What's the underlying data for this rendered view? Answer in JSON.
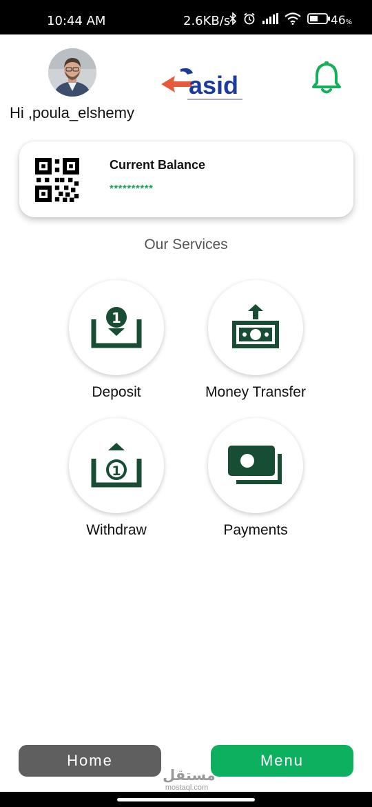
{
  "status_bar": {
    "time": "10:44 AM",
    "network_speed": "2.6KB/s",
    "battery": "46",
    "battery_unit": "%",
    "icons": [
      "bluetooth-icon",
      "alarm-icon",
      "signal-icon",
      "wifi-icon",
      "battery-icon"
    ]
  },
  "header": {
    "greeting": "Hi ,poula_elshemy",
    "logo_text": "asid",
    "logo_colors": {
      "primary": "#1b3a9c",
      "arrow": "#e85a3c"
    },
    "bell_color": "#12b05a"
  },
  "balance": {
    "title": "Current Balance",
    "value": "**********",
    "value_color": "#1aa35a"
  },
  "services": {
    "title": "Our Services",
    "icon_color": "#174d33",
    "items": [
      {
        "label": "Deposit",
        "icon": "deposit-icon"
      },
      {
        "label": "Money Transfer",
        "icon": "money-transfer-icon"
      },
      {
        "label": "Withdraw",
        "icon": "withdraw-icon"
      },
      {
        "label": "Payments",
        "icon": "payments-icon"
      }
    ]
  },
  "bottom_nav": {
    "home_label": "Home",
    "menu_label": "Menu",
    "home_color": "#5f5f5f",
    "menu_color": "#0db05f"
  },
  "watermark": {
    "arabic": "مستقل",
    "latin": "mostaql.com"
  }
}
